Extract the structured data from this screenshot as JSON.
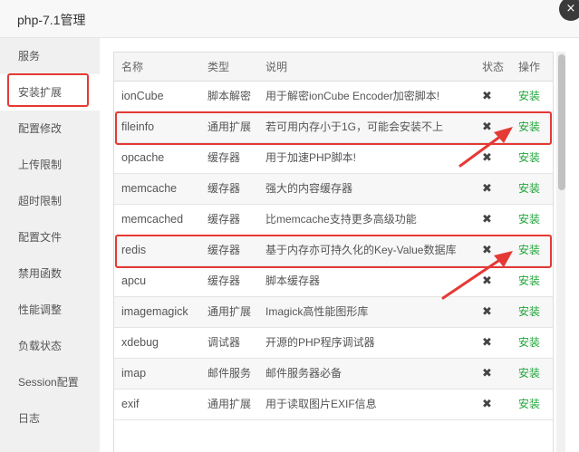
{
  "window": {
    "title": "php-7.1管理",
    "close_icon": "×"
  },
  "sidebar": {
    "items": [
      {
        "label": "服务"
      },
      {
        "label": "安装扩展"
      },
      {
        "label": "配置修改"
      },
      {
        "label": "上传限制"
      },
      {
        "label": "超时限制"
      },
      {
        "label": "配置文件"
      },
      {
        "label": "禁用函数"
      },
      {
        "label": "性能调整"
      },
      {
        "label": "负载状态"
      },
      {
        "label": "Session配置"
      },
      {
        "label": "日志"
      }
    ],
    "active_index": 1
  },
  "table": {
    "headers": {
      "name": "名称",
      "type": "类型",
      "desc": "说明",
      "status": "状态",
      "action": "操作"
    },
    "rows": [
      {
        "name": "ionCube",
        "type": "脚本解密",
        "desc": "用于解密ionCube Encoder加密脚本!",
        "status": "✖",
        "action": "安装"
      },
      {
        "name": "fileinfo",
        "type": "通用扩展",
        "desc": "若可用内存小于1G，可能会安装不上",
        "status": "✖",
        "action": "安装"
      },
      {
        "name": "opcache",
        "type": "缓存器",
        "desc": "用于加速PHP脚本!",
        "status": "✖",
        "action": "安装"
      },
      {
        "name": "memcache",
        "type": "缓存器",
        "desc": "强大的内容缓存器",
        "status": "✖",
        "action": "安装"
      },
      {
        "name": "memcached",
        "type": "缓存器",
        "desc": "比memcache支持更多高级功能",
        "status": "✖",
        "action": "安装"
      },
      {
        "name": "redis",
        "type": "缓存器",
        "desc": "基于内存亦可持久化的Key-Value数据库",
        "status": "✖",
        "action": "安装"
      },
      {
        "name": "apcu",
        "type": "缓存器",
        "desc": "脚本缓存器",
        "status": "✖",
        "action": "安装"
      },
      {
        "name": "imagemagick",
        "type": "通用扩展",
        "desc": "Imagick高性能图形库",
        "status": "✖",
        "action": "安装"
      },
      {
        "name": "xdebug",
        "type": "调试器",
        "desc": "开源的PHP程序调试器",
        "status": "✖",
        "action": "安装"
      },
      {
        "name": "imap",
        "type": "邮件服务",
        "desc": "邮件服务器必备",
        "status": "✖",
        "action": "安装"
      },
      {
        "name": "exif",
        "type": "通用扩展",
        "desc": "用于读取图片EXIF信息",
        "status": "✖",
        "action": "安装"
      }
    ]
  },
  "colors": {
    "install_green": "#20a53a",
    "highlight_red": "#e53935"
  }
}
